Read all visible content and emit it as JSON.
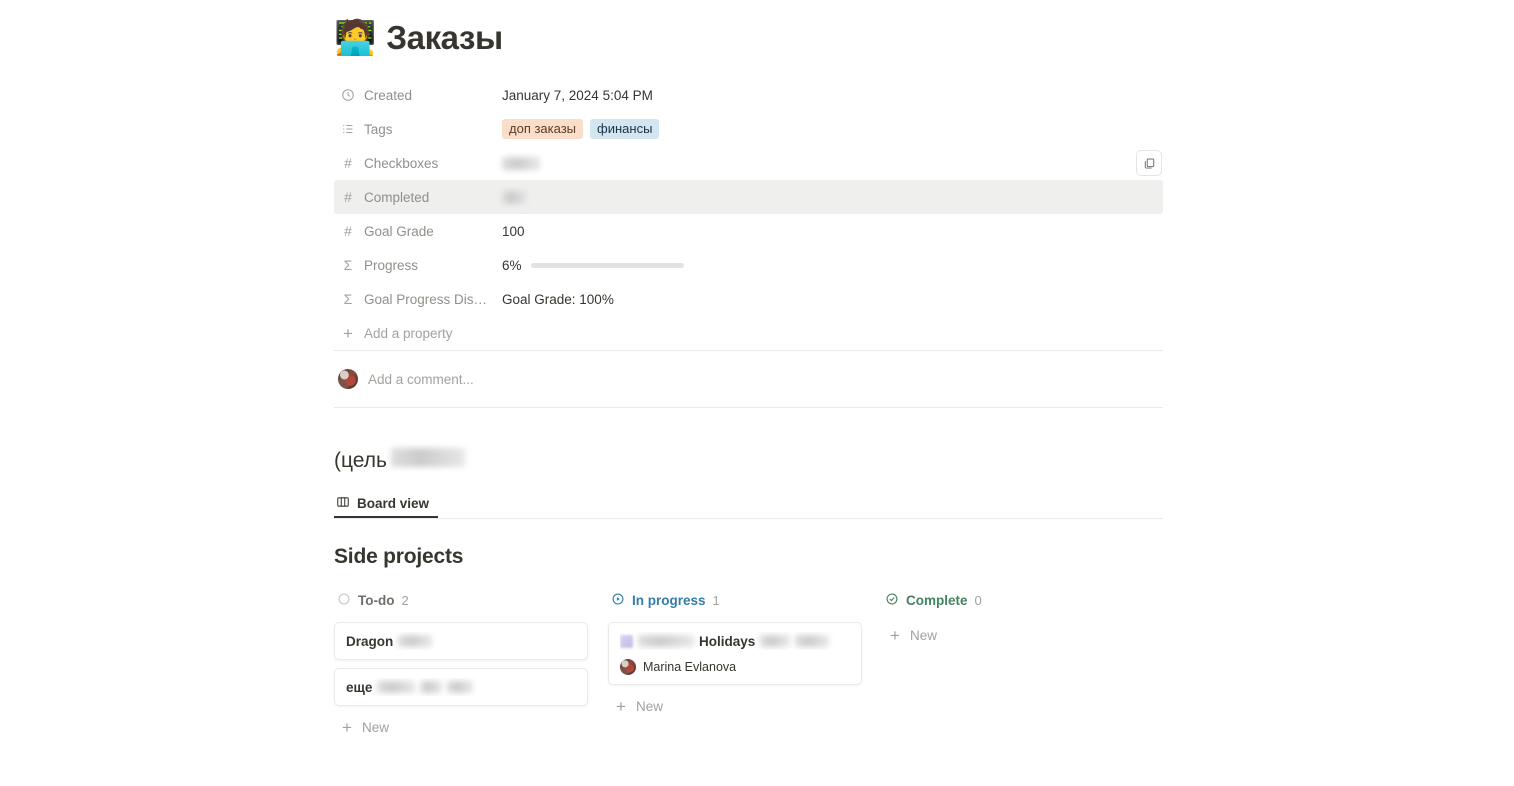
{
  "page": {
    "emoji": "🧑‍💻",
    "title": "Заказы"
  },
  "properties": [
    {
      "icon": "clock-icon",
      "label": "Created",
      "value": "January 7, 2024 5:04 PM"
    },
    {
      "icon": "list-icon",
      "label": "Tags",
      "value": ""
    },
    {
      "icon": "number-icon",
      "label": "Checkboxes",
      "value": ""
    },
    {
      "icon": "number-icon",
      "label": "Completed",
      "value": ""
    },
    {
      "icon": "number-icon",
      "label": "Goal Grade",
      "value": "100"
    },
    {
      "icon": "sigma-icon",
      "label": "Progress",
      "value": "6%"
    },
    {
      "icon": "sigma-icon",
      "label": "Goal Progress Dis…",
      "value": "Goal Grade: 100%"
    }
  ],
  "tags": [
    {
      "label": "доп заказы",
      "color": "#fadec9"
    },
    {
      "label": "финансы",
      "color": "#d3e5ef"
    }
  ],
  "progress": {
    "percent_label": "6%",
    "percent": 6,
    "fill_color": "#6a9a78",
    "track_color": "#e3e2e0"
  },
  "add_property_label": "Add a property",
  "comment": {
    "placeholder": "Add a comment..."
  },
  "subpage": {
    "title_prefix": "(цель",
    "tab_label": "Board view"
  },
  "board": {
    "title": "Side projects",
    "columns": [
      {
        "name": "To-do",
        "count": "2",
        "icon": "circle-icon",
        "color": "#6f6e69",
        "new_label": "New",
        "cards": [
          {
            "title": "Dragon",
            "redacted": true,
            "person": null
          }
        ]
      },
      {
        "name": "In progress",
        "count": "1",
        "icon": "play-circle-icon",
        "color": "#337ea9",
        "new_label": "New",
        "cards": [
          {
            "title": "Holidays",
            "redacted": true,
            "person": "Marina Evlanova"
          }
        ]
      },
      {
        "name": "Complete",
        "count": "0",
        "icon": "check-circle-icon",
        "color": "#448361",
        "new_label": "New",
        "cards": []
      }
    ],
    "todo_card_two_label": "еще"
  }
}
